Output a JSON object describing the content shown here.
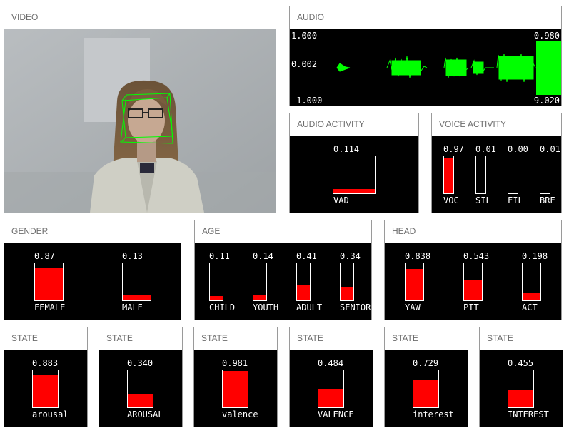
{
  "video": {
    "title": "VIDEO"
  },
  "audio": {
    "title": "AUDIO",
    "y_max": "1.000",
    "y_mid": "0.002",
    "y_min": "-1.000",
    "right_top": "-0.980",
    "right_bottom": "9.020",
    "waveform_color": "#00ff00"
  },
  "audio_activity": {
    "title": "AUDIO ACTIVITY",
    "bars": [
      {
        "value_text": "0.114",
        "value": 0.114,
        "label": "VAD"
      }
    ]
  },
  "voice_activity": {
    "title": "VOICE ACTIVITY",
    "bars": [
      {
        "value_text": "0.97",
        "value": 0.97,
        "label": "VOC"
      },
      {
        "value_text": "0.01",
        "value": 0.01,
        "label": "SIL"
      },
      {
        "value_text": "0.00",
        "value": 0.0,
        "label": "FIL"
      },
      {
        "value_text": "0.01",
        "value": 0.01,
        "label": "BRE"
      }
    ]
  },
  "gender": {
    "title": "GENDER",
    "bars": [
      {
        "value_text": "0.87",
        "value": 0.87,
        "label": "FEMALE"
      },
      {
        "value_text": "0.13",
        "value": 0.13,
        "label": "MALE"
      }
    ]
  },
  "age": {
    "title": "AGE",
    "bars": [
      {
        "value_text": "0.11",
        "value": 0.11,
        "label": "CHILD"
      },
      {
        "value_text": "0.14",
        "value": 0.14,
        "label": "YOUTH"
      },
      {
        "value_text": "0.41",
        "value": 0.41,
        "label": "ADULT"
      },
      {
        "value_text": "0.34",
        "value": 0.34,
        "label": "SENIOR"
      }
    ]
  },
  "head": {
    "title": "HEAD",
    "bars": [
      {
        "value_text": "0.838",
        "value": 0.838,
        "label": "YAW"
      },
      {
        "value_text": "0.543",
        "value": 0.543,
        "label": "PIT"
      },
      {
        "value_text": "0.198",
        "value": 0.198,
        "label": "ACT"
      }
    ]
  },
  "states": [
    {
      "title": "STATE",
      "value_text": "0.883",
      "value": 0.883,
      "label": "arousal"
    },
    {
      "title": "STATE",
      "value_text": "0.340",
      "value": 0.34,
      "label": "AROUSAL"
    },
    {
      "title": "STATE",
      "value_text": "0.981",
      "value": 0.981,
      "label": "valence"
    },
    {
      "title": "STATE",
      "value_text": "0.484",
      "value": 0.484,
      "label": "VALENCE"
    },
    {
      "title": "STATE",
      "value_text": "0.729",
      "value": 0.729,
      "label": "interest"
    },
    {
      "title": "STATE",
      "value_text": "0.455",
      "value": 0.455,
      "label": "INTEREST"
    }
  ],
  "colors": {
    "bar_fill": "#ff0000",
    "panel_bg": "#000000",
    "waveform": "#00ff00",
    "face_box": "#00ff00"
  }
}
